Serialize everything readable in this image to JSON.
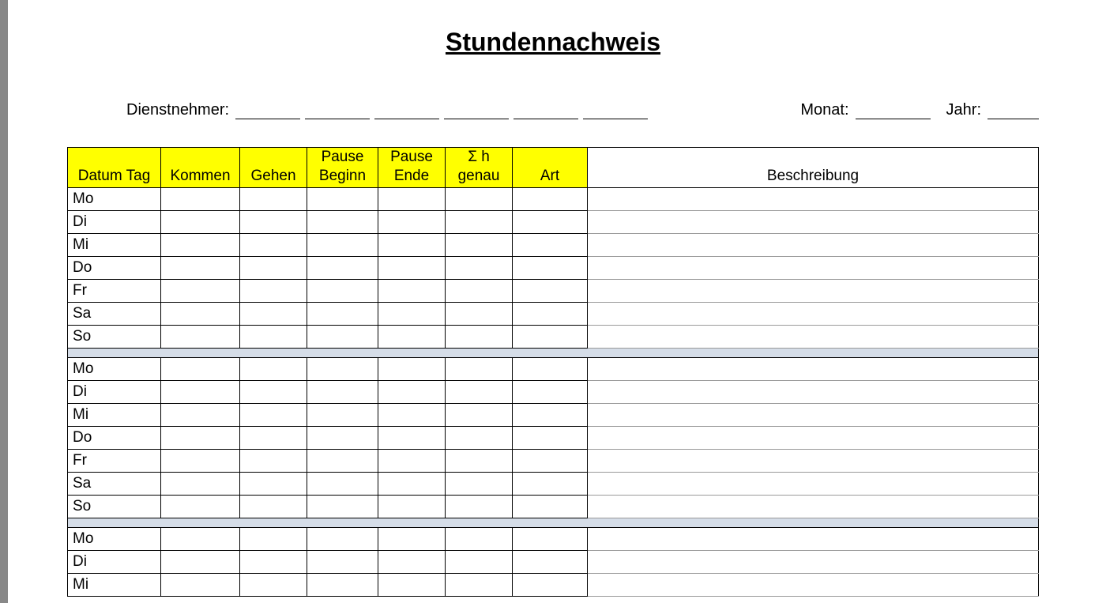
{
  "title": "Stundennachweis",
  "meta": {
    "employee_label": "Dienstnehmer:",
    "month_label": "Monat:",
    "year_label": "Jahr:"
  },
  "headers": {
    "datum_tag": "Datum Tag",
    "kommen": "Kommen",
    "gehen": "Gehen",
    "pause_beginn_l1": "Pause",
    "pause_beginn_l2": "Beginn",
    "pause_ende_l1": "Pause",
    "pause_ende_l2": "Ende",
    "sum_h_l1": "Σ h",
    "sum_h_l2": "genau",
    "art": "Art",
    "beschreibung": "Beschreibung"
  },
  "weeks": [
    {
      "days": [
        {
          "tag": "Mo",
          "kommen": "",
          "gehen": "",
          "pause_beginn": "",
          "pause_ende": "",
          "sum_h": "",
          "art": "",
          "beschreibung": ""
        },
        {
          "tag": "Di",
          "kommen": "",
          "gehen": "",
          "pause_beginn": "",
          "pause_ende": "",
          "sum_h": "",
          "art": "",
          "beschreibung": ""
        },
        {
          "tag": "Mi",
          "kommen": "",
          "gehen": "",
          "pause_beginn": "",
          "pause_ende": "",
          "sum_h": "",
          "art": "",
          "beschreibung": ""
        },
        {
          "tag": "Do",
          "kommen": "",
          "gehen": "",
          "pause_beginn": "",
          "pause_ende": "",
          "sum_h": "",
          "art": "",
          "beschreibung": ""
        },
        {
          "tag": "Fr",
          "kommen": "",
          "gehen": "",
          "pause_beginn": "",
          "pause_ende": "",
          "sum_h": "",
          "art": "",
          "beschreibung": ""
        },
        {
          "tag": "Sa",
          "kommen": "",
          "gehen": "",
          "pause_beginn": "",
          "pause_ende": "",
          "sum_h": "",
          "art": "",
          "beschreibung": ""
        },
        {
          "tag": "So",
          "kommen": "",
          "gehen": "",
          "pause_beginn": "",
          "pause_ende": "",
          "sum_h": "",
          "art": "",
          "beschreibung": ""
        }
      ]
    },
    {
      "days": [
        {
          "tag": "Mo",
          "kommen": "",
          "gehen": "",
          "pause_beginn": "",
          "pause_ende": "",
          "sum_h": "",
          "art": "",
          "beschreibung": ""
        },
        {
          "tag": "Di",
          "kommen": "",
          "gehen": "",
          "pause_beginn": "",
          "pause_ende": "",
          "sum_h": "",
          "art": "",
          "beschreibung": ""
        },
        {
          "tag": "Mi",
          "kommen": "",
          "gehen": "",
          "pause_beginn": "",
          "pause_ende": "",
          "sum_h": "",
          "art": "",
          "beschreibung": ""
        },
        {
          "tag": "Do",
          "kommen": "",
          "gehen": "",
          "pause_beginn": "",
          "pause_ende": "",
          "sum_h": "",
          "art": "",
          "beschreibung": ""
        },
        {
          "tag": "Fr",
          "kommen": "",
          "gehen": "",
          "pause_beginn": "",
          "pause_ende": "",
          "sum_h": "",
          "art": "",
          "beschreibung": ""
        },
        {
          "tag": "Sa",
          "kommen": "",
          "gehen": "",
          "pause_beginn": "",
          "pause_ende": "",
          "sum_h": "",
          "art": "",
          "beschreibung": ""
        },
        {
          "tag": "So",
          "kommen": "",
          "gehen": "",
          "pause_beginn": "",
          "pause_ende": "",
          "sum_h": "",
          "art": "",
          "beschreibung": ""
        }
      ]
    },
    {
      "days": [
        {
          "tag": "Mo",
          "kommen": "",
          "gehen": "",
          "pause_beginn": "",
          "pause_ende": "",
          "sum_h": "",
          "art": "",
          "beschreibung": ""
        },
        {
          "tag": "Di",
          "kommen": "",
          "gehen": "",
          "pause_beginn": "",
          "pause_ende": "",
          "sum_h": "",
          "art": "",
          "beschreibung": ""
        },
        {
          "tag": "Mi",
          "kommen": "",
          "gehen": "",
          "pause_beginn": "",
          "pause_ende": "",
          "sum_h": "",
          "art": "",
          "beschreibung": ""
        }
      ]
    }
  ]
}
